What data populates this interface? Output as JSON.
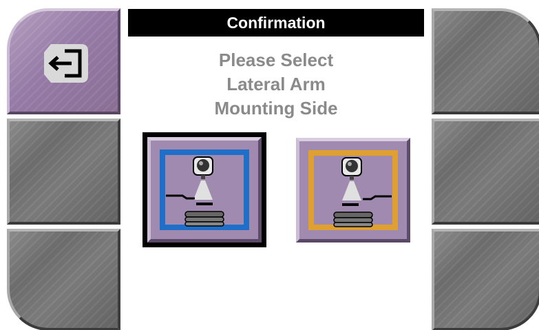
{
  "header": {
    "title": "Confirmation"
  },
  "prompt": {
    "lines": [
      "Please Select",
      "Lateral Arm",
      "Mounting Side"
    ]
  },
  "left_buttons": [
    {
      "icon": "exit-icon",
      "selected": true
    },
    {
      "icon": ""
    },
    {
      "icon": ""
    }
  ],
  "right_buttons": [
    {
      "icon": ""
    },
    {
      "icon": ""
    },
    {
      "icon": ""
    }
  ],
  "options": [
    {
      "icon": "lateral-arm-left-icon",
      "selected": true,
      "frame_color": "#1f6fc8"
    },
    {
      "icon": "lateral-arm-right-icon",
      "selected": false,
      "frame_color": "#e0a030"
    }
  ],
  "colors": {
    "purple_button": "#9a7fab",
    "gray_button": "#777777",
    "title_bg": "#000000",
    "prompt_text": "#8a8a8a"
  }
}
